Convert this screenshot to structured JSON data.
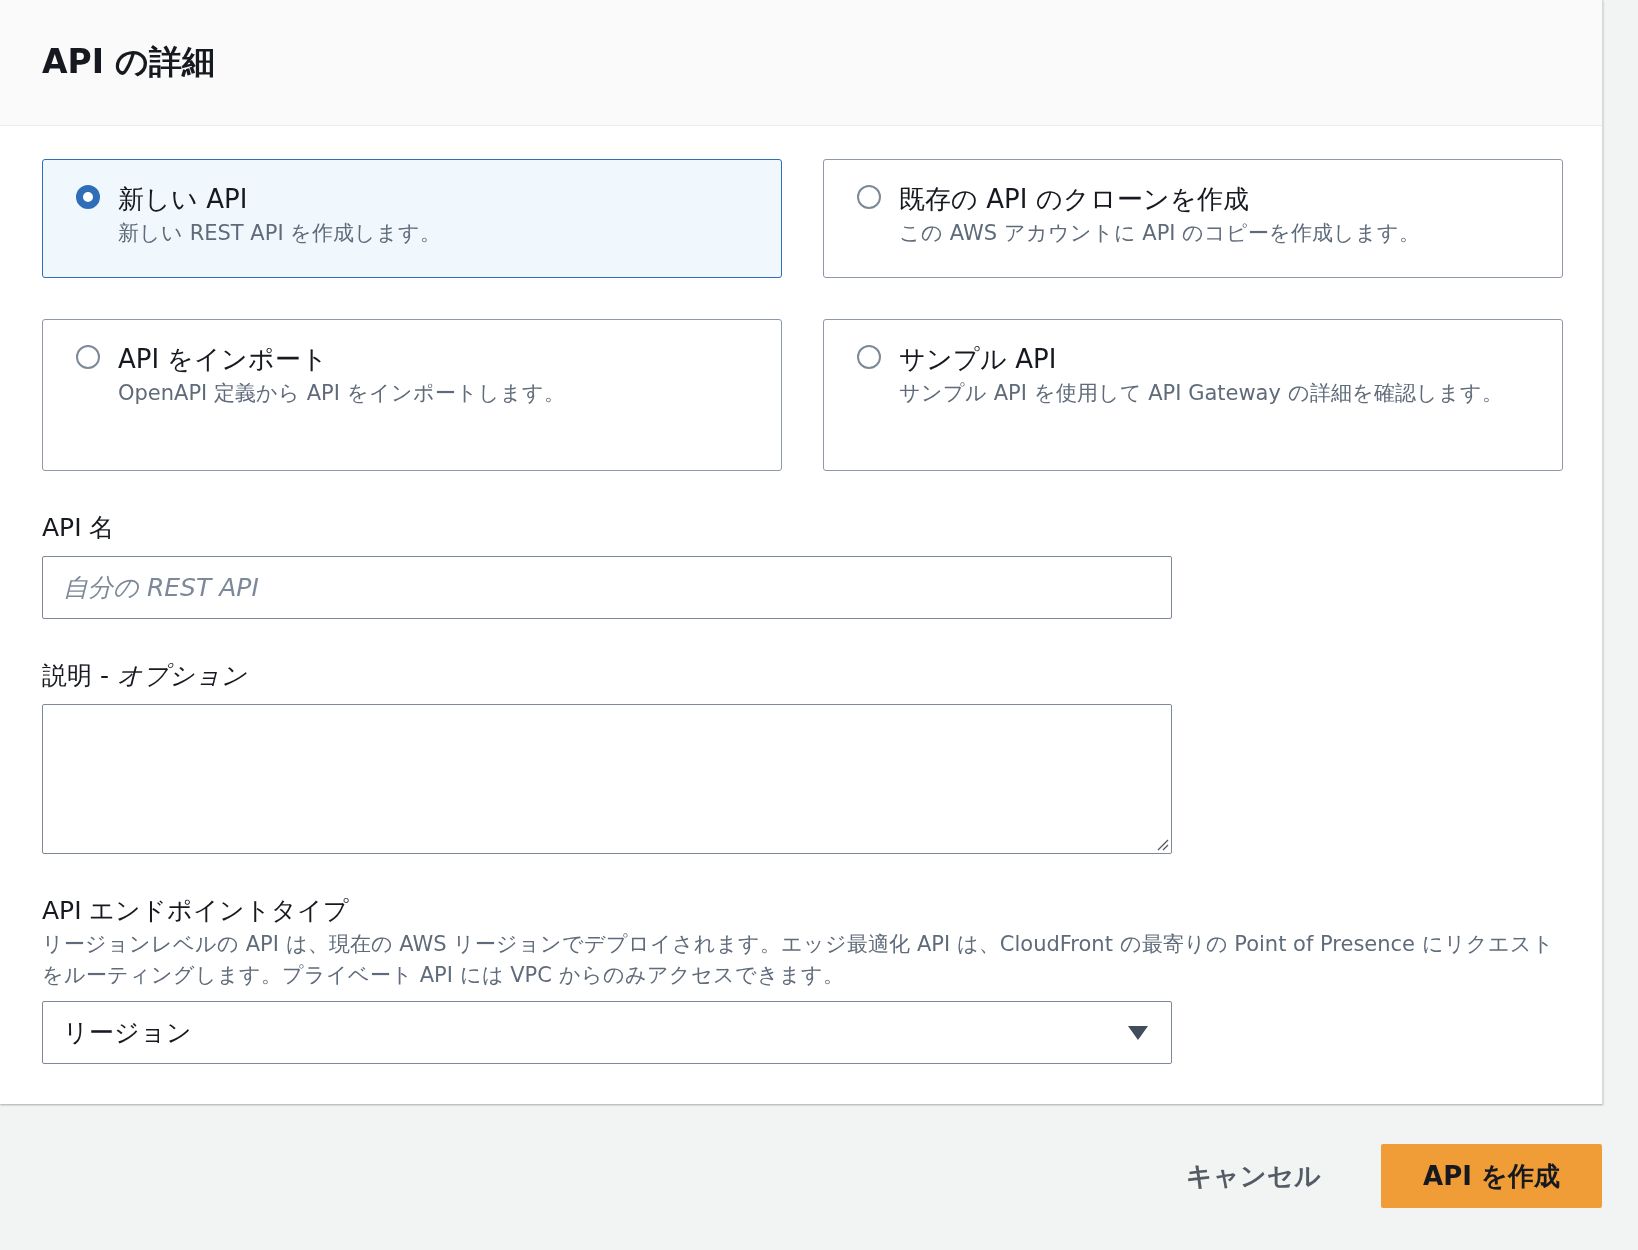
{
  "panel": {
    "title": "API の詳細"
  },
  "options": [
    {
      "title": "新しい API",
      "description": "新しい REST API を作成します。",
      "selected": true
    },
    {
      "title": "既存の API のクローンを作成",
      "description": "この AWS アカウントに API のコピーを作成します。",
      "selected": false
    },
    {
      "title": "API をインポート",
      "description": "OpenAPI 定義から API をインポートします。",
      "selected": false
    },
    {
      "title": "サンプル API",
      "description": "サンプル API を使用して API Gateway の詳細を確認します。",
      "selected": false
    }
  ],
  "fields": [
    {
      "kind": "input",
      "label": "API 名",
      "placeholder": "自分の REST API"
    },
    {
      "kind": "textarea",
      "label": "説明 - *オプション*"
    },
    {
      "kind": "select",
      "label": "API エンドポイントタイプ",
      "description": "リージョンレベルの API は、現在の AWS リージョンでデプロイされます。エッジ最適化 API は、CloudFront の最寄りの Point of Presence にリクエストをルーティングします。プライベート API には VPC からのみアクセスできます。",
      "value": "リージョン"
    }
  ],
  "buttons": [
    {
      "kind": "link",
      "label": "キャンセル"
    },
    {
      "kind": "primary",
      "label": "API を作成"
    }
  ]
}
